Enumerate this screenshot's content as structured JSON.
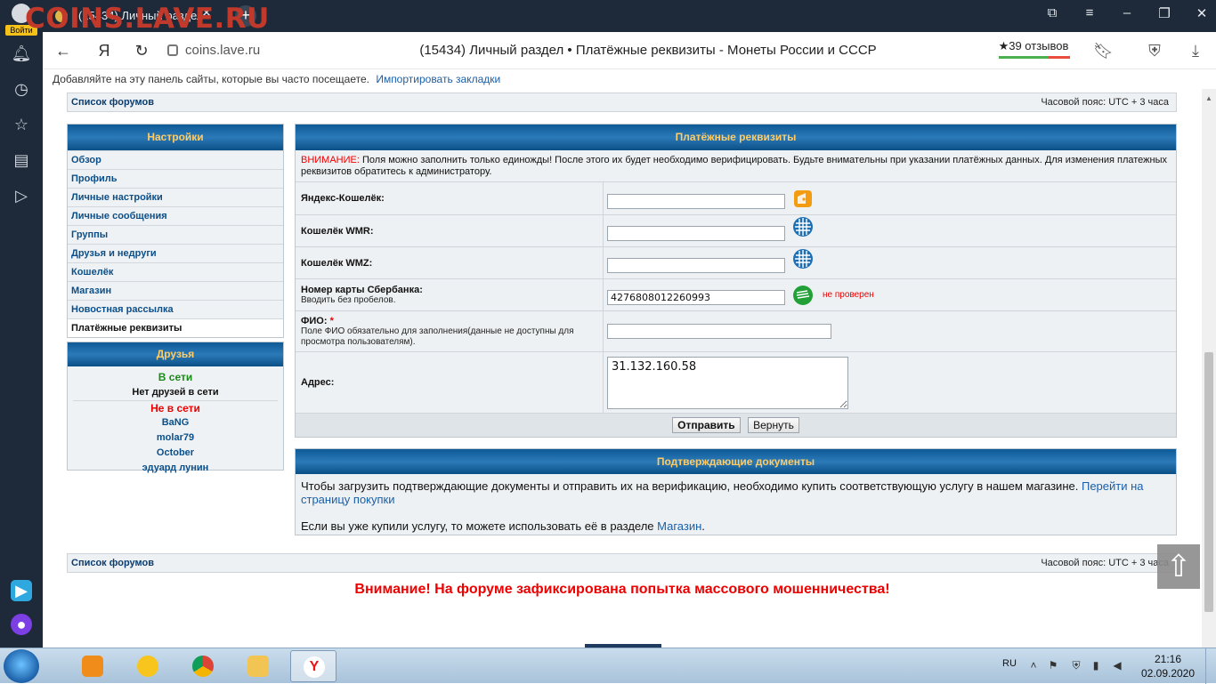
{
  "browser": {
    "login_label": "Войти",
    "logo_overlay": "COINS.LAVE.RU",
    "tab_title": "(15434) Личный раздел",
    "tab_close": "✕",
    "new_tab": "+",
    "url": "coins.lave.ru",
    "page_title": "(15434) Личный раздел • Платёжные реквизиты - Монеты России и СССР",
    "reviews": "★39 отзывов",
    "bookmarks_text": "Добавляйте на эту панель сайты, которые вы часто посещаете.",
    "bookmarks_link": "Импортировать закладки"
  },
  "nav": {
    "forum_list": "Список форумов",
    "timezone": "Часовой пояс: UTC + 3 часа"
  },
  "settings": {
    "title": "Настройки",
    "items": [
      {
        "label": "Обзор"
      },
      {
        "label": "Профиль"
      },
      {
        "label": "Личные настройки"
      },
      {
        "label": "Личные сообщения"
      },
      {
        "label": "Группы"
      },
      {
        "label": "Друзья и недруги"
      },
      {
        "label": "Кошелёк"
      },
      {
        "label": "Магазин"
      },
      {
        "label": "Новостная рассылка"
      },
      {
        "label": "Платёжные реквизиты"
      }
    ]
  },
  "friends": {
    "title": "Друзья",
    "online": "В сети",
    "no_friends_online": "Нет друзей в сети",
    "offline": "Не в сети",
    "names": [
      "BaNG",
      "molar79",
      "October",
      "эдуард лунин"
    ]
  },
  "payment": {
    "title": "Платёжные реквизиты",
    "warning_label": "ВНИМАНИЕ:",
    "warning_text": "Поля можно заполнить только единожды! После этого их будет необходимо верифицировать. Будьте внимательны при указании платёжных данных. Для изменения платежных реквизитов обратитесь к администратору.",
    "yandex_label": "Яндекс-Кошелёк:",
    "yandex_value": "",
    "wmr_label": "Кошелёк WMR:",
    "wmr_value": "",
    "wmz_label": "Кошелёк WMZ:",
    "wmz_value": "",
    "sber_label": "Номер карты Сбербанка:",
    "sber_hint": "Вводить без пробелов.",
    "sber_value": "4276808012260993",
    "sber_status": "не проверен",
    "fio_label": "ФИО:",
    "fio_star": "*",
    "fio_hint": "Поле ФИО обязательно для заполнения(данные не доступны для просмотра пользователям).",
    "fio_value": "",
    "address_label": "Адрес:",
    "address_value": "31.132.160.58",
    "submit": "Отправить",
    "reset": "Вернуть"
  },
  "docs": {
    "title": "Подтверждающие документы",
    "text1": "Чтобы загрузить подтверждающие документы и отправить их на верификацию, необходимо купить соответствующую услугу в нашем магазине.",
    "link1": "Перейти на страницу покупки",
    "text2": "Если вы уже купили услугу, то можете использовать её в разделе",
    "link2": "Магазин",
    "text2_end": "."
  },
  "alert": "Внимание! На форуме зафиксирована попытка массового мошенничества!",
  "taskbar": {
    "lang": "RU",
    "time": "21:16",
    "date": "02.09.2020"
  },
  "colors": {
    "panel_header": "#1a6aa8",
    "panel_header_text": "#ffcc66",
    "warning": "#ee0000",
    "link": "#1a5fa8"
  }
}
